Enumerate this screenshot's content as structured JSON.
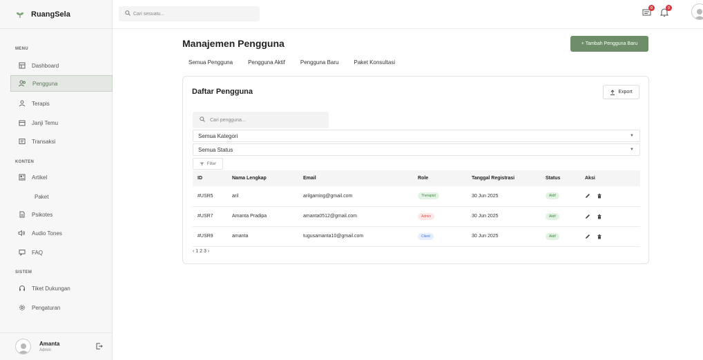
{
  "brand": {
    "name": "RuangSela"
  },
  "sidebar": {
    "sections": {
      "menu": "MENU",
      "konten": "KONTEN",
      "sistem": "SISTEM"
    },
    "items": [
      {
        "label": "Dashboard",
        "icon": "dashboard-icon"
      },
      {
        "label": "Pengguna",
        "icon": "users-icon",
        "active": true
      },
      {
        "label": "Terapis",
        "icon": "user-icon"
      },
      {
        "label": "Janji Temu",
        "icon": "calendar-icon"
      },
      {
        "label": "Transaksi",
        "icon": "receipt-icon"
      },
      {
        "label": "Artikel",
        "icon": "article-icon"
      },
      {
        "label": "Paket",
        "icon": ""
      },
      {
        "label": "Psikotes",
        "icon": "document-icon"
      },
      {
        "label": "Audio Tones",
        "icon": "audio-icon"
      },
      {
        "label": "FAQ",
        "icon": "chat-icon"
      },
      {
        "label": "Tiket Dukungan",
        "icon": "headset-icon"
      },
      {
        "label": "Pengaturan",
        "icon": "gear-icon"
      }
    ],
    "profile": {
      "name": "Amanta",
      "role": "Admin"
    }
  },
  "topbar": {
    "search_placeholder": "Cari sesuatu...",
    "message_badge": "0",
    "notification_badge": "0"
  },
  "main": {
    "title": "Manajemen Pengguna",
    "add_button": "+ Tambah Pengguna Baru",
    "tabs": [
      "Semua Pengguna",
      "Pengguna Aktif",
      "Pengguna Baru",
      "Paket Konsultasi"
    ],
    "card": {
      "title": "Daftar Pengguna",
      "export_label": "Export",
      "search_placeholder": "Cari pengguna...",
      "category_select": "Semua Kategori",
      "status_select": "Semua Status",
      "filter_label": "Filter",
      "columns": [
        "ID",
        "Nama Lengkap",
        "Email",
        "Role",
        "Tanggal Registrasi",
        "Status",
        "Aksi"
      ],
      "rows": [
        {
          "id": "#USR5",
          "name": "aril",
          "email": "arilgaming@gmail.com",
          "role": "Therapist",
          "date": "30 Jun 2025",
          "status": "Aktif"
        },
        {
          "id": "#USR7",
          "name": "Amanta Pradipa",
          "email": "amanta0512@gmail.com",
          "role": "Admin",
          "date": "30 Jun 2025",
          "status": "Aktif"
        },
        {
          "id": "#USR9",
          "name": "amanta",
          "email": "tugusamanta10@gmail.com",
          "role": "Client",
          "date": "30 Jun 2025",
          "status": "Aktif"
        }
      ],
      "pagination": "‹ 1 2 3 ›"
    }
  },
  "colors": {
    "accent": "#6d8e69",
    "therapist_bg": "#e3f3e3",
    "therapist_fg": "#3f8a3f",
    "admin_bg": "#fde8e6",
    "admin_fg": "#d9534f",
    "client_bg": "#e4eefc",
    "client_fg": "#4a7ac9",
    "status_bg": "#e3f3e3",
    "status_fg": "#3f8a3f"
  }
}
